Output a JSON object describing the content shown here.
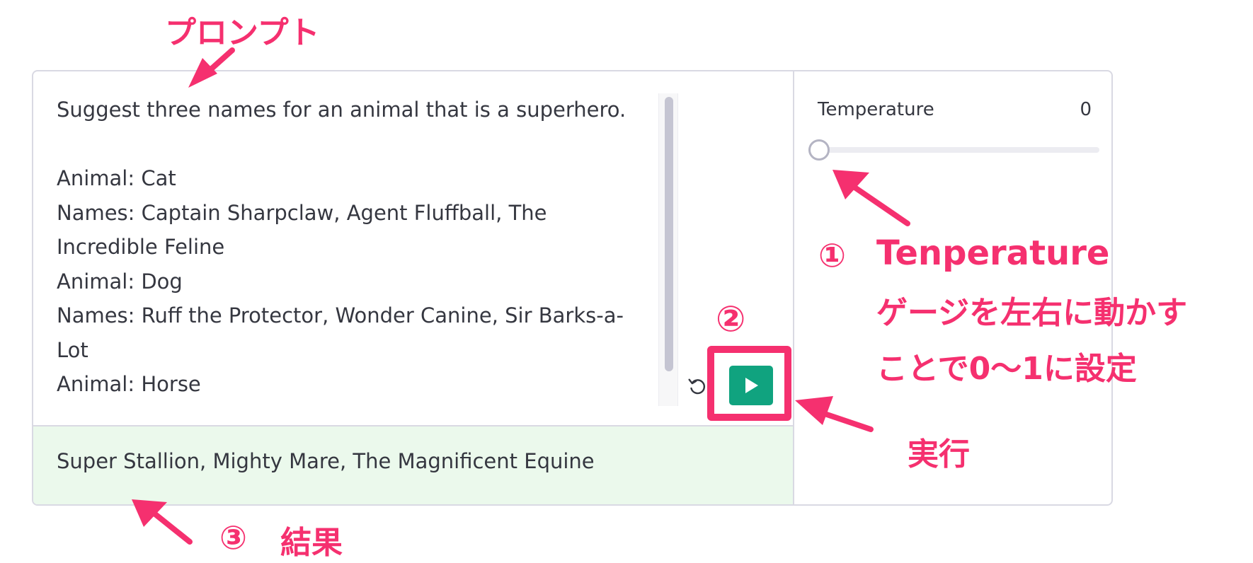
{
  "playground": {
    "prompt_lines": [
      "Suggest three names for an animal that is a superhero.",
      "",
      "Animal: Cat",
      "Names: Captain Sharpclaw, Agent Fluffball, The",
      "Incredible Feline",
      "Animal: Dog",
      "Names: Ruff the Protector, Wonder Canine, Sir Barks-a-",
      "Lot",
      "Animal: Horse"
    ],
    "result_text": "Super Stallion, Mighty Mare, The Magnificent Equine",
    "submit_icon": "play-icon",
    "regenerate_icon": "undo-icon"
  },
  "settings": {
    "temperature_label": "Temperature",
    "temperature_value": "0",
    "temperature_level": 0
  },
  "annotations": {
    "prompt_label": "プロンプト",
    "step1_number": "①",
    "step1_title": "Tenperature",
    "step1_line2": "ゲージを左右に動かす",
    "step1_line3": "ことで0〜1に設定",
    "step2_number": "②",
    "step2_label": "実行",
    "step3_number": "③",
    "step3_label": "結果"
  },
  "colors": {
    "accent": "#10a37f",
    "annotation": "#f5306f",
    "result_bg": "#ebf9ec"
  }
}
